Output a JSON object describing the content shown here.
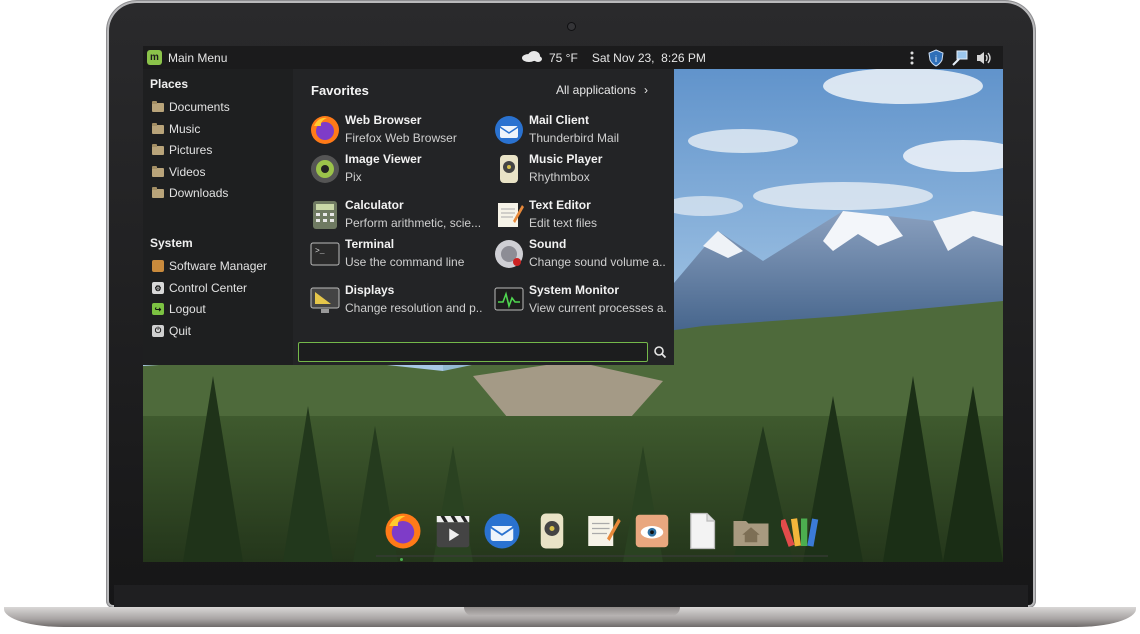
{
  "panel": {
    "menu_label": "Main Menu",
    "temperature": "75 °F",
    "datetime": "Sat Nov 23,  8:26 PM"
  },
  "menu": {
    "places_title": "Places",
    "places": [
      {
        "label": "Documents"
      },
      {
        "label": "Music"
      },
      {
        "label": "Pictures"
      },
      {
        "label": "Videos"
      },
      {
        "label": "Downloads"
      }
    ],
    "system_title": "System",
    "system": [
      {
        "label": "Software Manager",
        "icon": "software-manager-icon",
        "color": "#c98a3c"
      },
      {
        "label": "Control Center",
        "icon": "control-center-icon",
        "color": "#d8d8d8"
      },
      {
        "label": "Logout",
        "icon": "logout-icon",
        "color": "#7cc242"
      },
      {
        "label": "Quit",
        "icon": "quit-icon",
        "color": "#d0d0d0"
      }
    ],
    "favorites_title": "Favorites",
    "all_applications": "All applications",
    "apps": [
      {
        "name": "Web Browser",
        "desc": "Firefox Web Browser",
        "icon": "firefox-icon"
      },
      {
        "name": "Mail Client",
        "desc": "Thunderbird Mail",
        "icon": "thunderbird-icon"
      },
      {
        "name": "Image Viewer",
        "desc": "Pix",
        "icon": "image-viewer-icon"
      },
      {
        "name": "Music Player",
        "desc": "Rhythmbox",
        "icon": "music-player-icon"
      },
      {
        "name": "Calculator",
        "desc": "Perform arithmetic, scie...",
        "icon": "calculator-icon"
      },
      {
        "name": "Text Editor",
        "desc": "Edit text files",
        "icon": "text-editor-icon"
      },
      {
        "name": "Terminal",
        "desc": "Use the command line",
        "icon": "terminal-icon"
      },
      {
        "name": "Sound",
        "desc": "Change sound volume a...",
        "icon": "sound-icon"
      },
      {
        "name": "Displays",
        "desc": "Change resolution and p...",
        "icon": "displays-icon"
      },
      {
        "name": "System Monitor",
        "desc": "View current processes a...",
        "icon": "system-monitor-icon"
      }
    ],
    "search_value": ""
  },
  "dock": [
    {
      "icon": "firefox-icon"
    },
    {
      "icon": "media-player-icon"
    },
    {
      "icon": "thunderbird-icon"
    },
    {
      "icon": "music-player-icon"
    },
    {
      "icon": "text-editor-icon"
    },
    {
      "icon": "image-viewer-icon"
    },
    {
      "icon": "document-icon"
    },
    {
      "icon": "home-folder-icon"
    },
    {
      "icon": "color-palette-icon"
    }
  ],
  "colors": {
    "accent": "#74b84a",
    "menu_bg": "#232426",
    "panel_bg": "#1b1b1c"
  }
}
